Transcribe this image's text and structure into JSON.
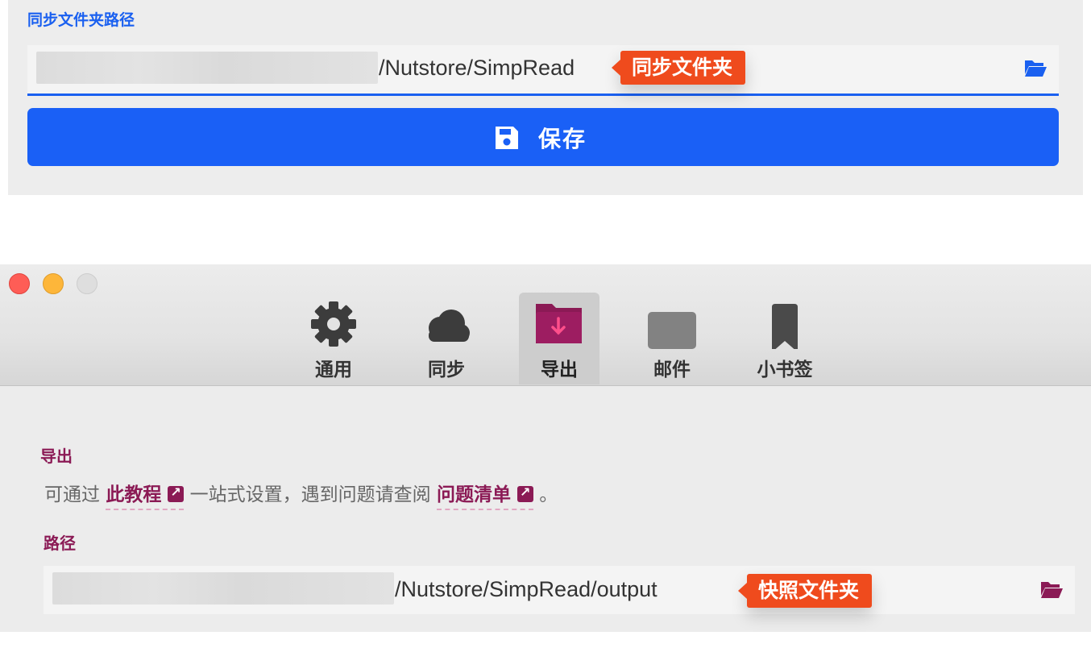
{
  "sync_panel": {
    "label": "同步文件夹路径",
    "path_suffix": "/Nutstore/SimpRead",
    "callout": "同步文件夹",
    "save_label": "保存",
    "accent_color": "#1a60f0"
  },
  "window": {
    "tabs": [
      {
        "label": "通用",
        "icon": "gear-icon"
      },
      {
        "label": "同步",
        "icon": "cloud-icon"
      },
      {
        "label": "导出",
        "icon": "folder-download-icon",
        "active": true
      },
      {
        "label": "邮件",
        "icon": "mail-icon"
      },
      {
        "label": "小书签",
        "icon": "bookmark-icon"
      }
    ],
    "export_title": "导出",
    "hint": {
      "prefix": "可通过",
      "link1": "此教程",
      "middle": "一站式设置，遇到问题请查阅",
      "link2": "问题清单",
      "suffix": "。"
    },
    "path_title": "路径",
    "path_suffix": "/Nutstore/SimpRead/output",
    "callout": "快照文件夹",
    "accent_color": "#8b1a55"
  },
  "callout_color": "#ef4b1d"
}
